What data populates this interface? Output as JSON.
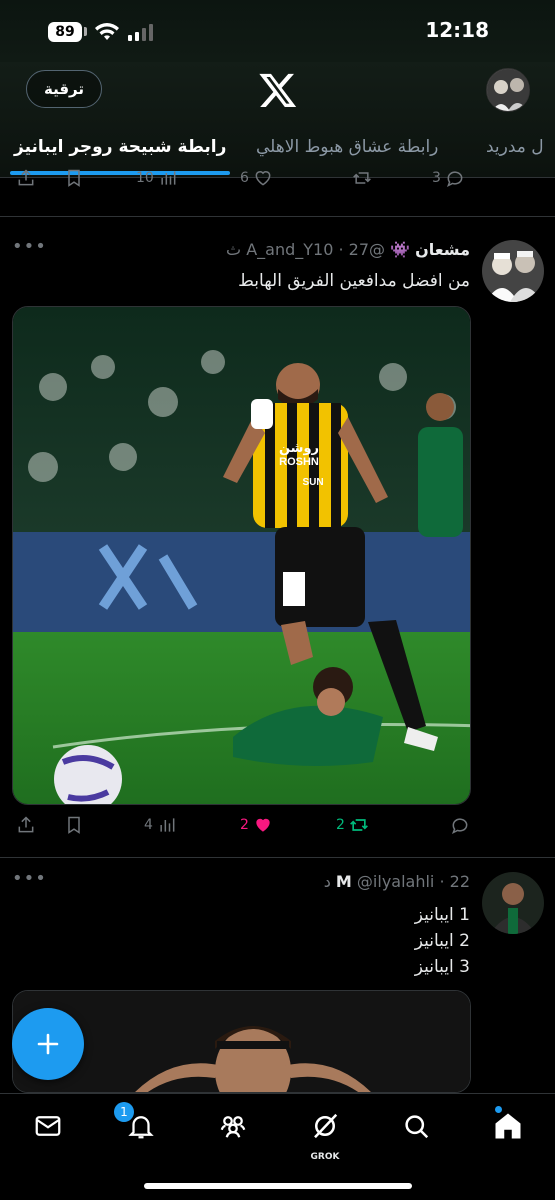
{
  "status_bar": {
    "battery": "89",
    "time": "12:18"
  },
  "header": {
    "upgrade_label": "ترقية"
  },
  "tabs": [
    {
      "label": "رابطة شبيحة روجر ايبانيز",
      "active": true
    },
    {
      "label": "رابطة عشاق هبوط الاهلي",
      "active": false
    },
    {
      "label": "ل مدريد",
      "active": false
    }
  ],
  "previous_post": {
    "views": "10",
    "likes": "6",
    "reposts": "",
    "replies": "3"
  },
  "posts": [
    {
      "display_name": "مشعان",
      "emoji": "👾",
      "handle": "@A_and_Y10",
      "time": "27 ث",
      "text": "من افضل مدافعين الفريق الهابط",
      "actions": {
        "views": "4",
        "likes": "2",
        "reposts": "2"
      }
    },
    {
      "display_name": "M",
      "handle": "@ilyalahli",
      "time": "22 د",
      "lines": [
        "1 ايبانيز",
        "2 ايبانيز",
        "3 ايبانيز"
      ]
    }
  ],
  "media_text": {
    "sponsor": "روشن",
    "sponsor_latin": "ROSHN",
    "number": "SUN"
  },
  "nav": {
    "notifications_badge": "1",
    "grok_label": "GROK"
  },
  "colors": {
    "accent": "#1d9bf0",
    "like": "#f91880",
    "repost": "#00ba7c",
    "background": "#000000"
  },
  "icons": [
    "share-icon",
    "bookmark-icon",
    "views-icon",
    "heart-icon",
    "repost-icon",
    "reply-icon",
    "mail-icon",
    "bell-icon",
    "people-icon",
    "grok-icon",
    "search-icon",
    "home-icon",
    "plus-icon",
    "x-logo"
  ]
}
